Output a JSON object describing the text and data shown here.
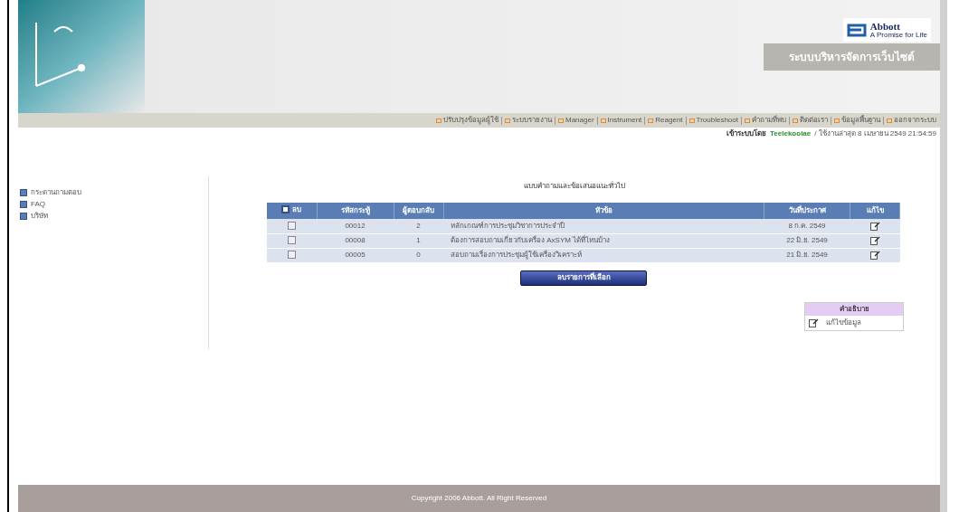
{
  "header": {
    "logo": "Abbott",
    "logo_tagline": "A Promise for Life",
    "title": "ระบบบริหารจัดการเว็บไซต์"
  },
  "nav": [
    "ปรับปรุงข้อมูลผู้ใช้",
    "ระบบรายงาน",
    "Manager",
    "Instrument",
    "Reagent",
    "Troubleshoot",
    "คำถามที่พบ",
    "ติดต่อเรา",
    "ข้อมูลพื้นฐาน",
    "ออกจากระบบ"
  ],
  "login": {
    "label": "เข้าระบบโดย",
    "user": "Teelekoolae",
    "info": "/ ใช้งานล่าสุด 8 เมษายน 2549 21:54:59"
  },
  "sidebar": {
    "items": [
      "กระดานถามตอบ",
      "FAQ",
      "บริษัท"
    ]
  },
  "main": {
    "title": "แบบคำถามและข้อเสนอแนะทั่วไป",
    "table": {
      "select_all_checked": false,
      "columns": [
        "ลบ",
        "รหัสกระทู้",
        "ผู้ตอบกลับ",
        "หัวข้อ",
        "วันที่ประกาศ",
        "แก้ไข"
      ],
      "rows": [
        {
          "checked": false,
          "code": "00012",
          "replies": "2",
          "subject": "หลักเกณฑ์การประชุมวิชาการประจำปี",
          "date": "8 ก.ค. 2549"
        },
        {
          "checked": false,
          "code": "00008",
          "replies": "1",
          "subject": "ต้องการสอบถามเกี่ยวกับเครื่อง AxSYM ได้ที่ไหนบ้าง",
          "date": "22 มิ.ย. 2549"
        },
        {
          "checked": false,
          "code": "00005",
          "replies": "0",
          "subject": "สอบถามเรื่องการประชุมผู้ใช้เครื่องวิเคราะห์",
          "date": "21 มิ.ย. 2549"
        }
      ]
    },
    "delete_button": "ลบรายการที่เลือก",
    "legend": {
      "title": "คำอธิบาย",
      "items": [
        "แก้ไขข้อมูล"
      ]
    }
  },
  "footer": "Copyright 2006 Abbott. All Right Reserved"
}
